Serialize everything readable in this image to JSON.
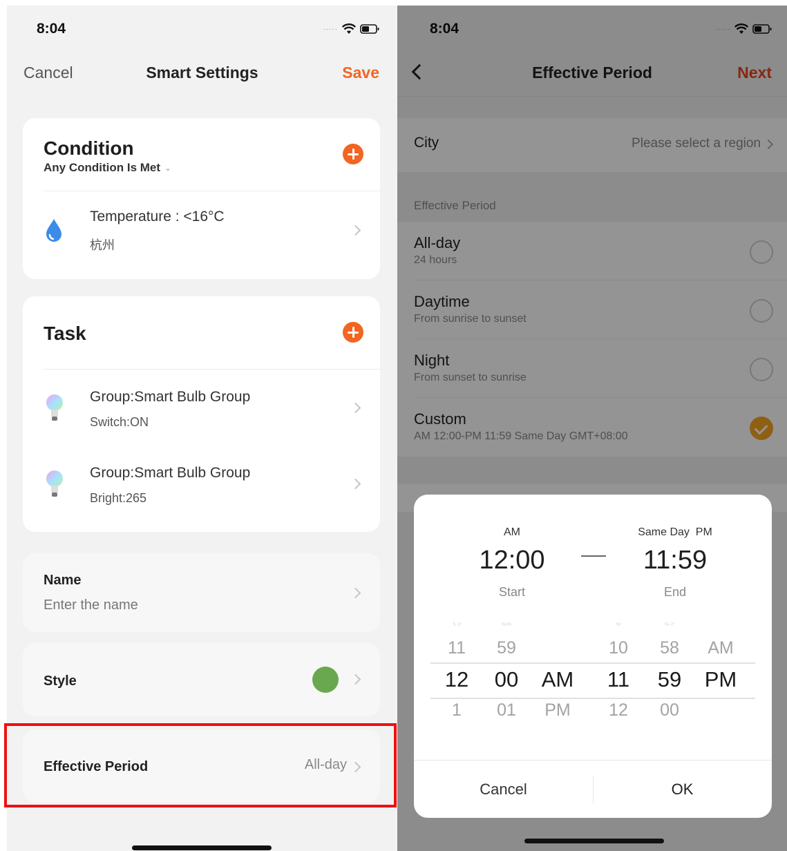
{
  "left": {
    "status": {
      "time": "8:04"
    },
    "nav": {
      "cancel": "Cancel",
      "title": "Smart Settings",
      "save": "Save"
    },
    "condition": {
      "title": "Condition",
      "mode": "Any Condition Is Met",
      "items": [
        {
          "icon": "water-drop-icon",
          "title": "Temperature : <16°C",
          "subtitle": "杭州"
        }
      ]
    },
    "task": {
      "title": "Task",
      "items": [
        {
          "icon": "smart-bulb-icon",
          "title": "Group:Smart Bulb Group",
          "subtitle": "Switch:ON"
        },
        {
          "icon": "smart-bulb-icon",
          "title": "Group:Smart Bulb Group",
          "subtitle": "Bright:265"
        }
      ]
    },
    "name": {
      "label": "Name",
      "placeholder": "Enter the name"
    },
    "style": {
      "label": "Style",
      "color": "#6aa84f"
    },
    "effective_period": {
      "label": "Effective Period",
      "value": "All-day"
    },
    "accent_color": "#f26522",
    "highlight_color": "#ef1010"
  },
  "right": {
    "status": {
      "time": "8:04"
    },
    "nav": {
      "title": "Effective Period",
      "next": "Next"
    },
    "city": {
      "label": "City",
      "value": "Please select a region"
    },
    "section_header": "Effective Period",
    "options": [
      {
        "title": "All-day",
        "subtitle": "24 hours",
        "checked": false
      },
      {
        "title": "Daytime",
        "subtitle": "From sunrise to sunset",
        "checked": false
      },
      {
        "title": "Night",
        "subtitle": "From sunset to sunrise",
        "checked": false
      },
      {
        "title": "Custom",
        "subtitle": "AM 12:00-PM 11:59 Same Day GMT+08:00",
        "checked": true
      }
    ],
    "picker": {
      "start": {
        "ampm": "AM",
        "time": "12:00",
        "caption": "Start"
      },
      "end": {
        "day_ampm": "Same Day  PM",
        "time": "11:59",
        "caption": "End"
      },
      "wheels": {
        "start_hour": {
          "prev": "11",
          "selected": "12",
          "next": "1"
        },
        "start_minute": {
          "prev": "59",
          "selected": "00",
          "next": "01"
        },
        "start_ampm": {
          "prev": "",
          "selected": "AM",
          "next": "PM"
        },
        "end_hour": {
          "prev": "10",
          "selected": "11",
          "next": "12"
        },
        "end_minute": {
          "prev": "58",
          "selected": "59",
          "next": "00"
        },
        "end_ampm": {
          "prev": "AM",
          "selected": "PM",
          "next": ""
        }
      },
      "cancel": "Cancel",
      "ok": "OK"
    },
    "checked_color": "#f6a623",
    "next_color": "#e8461f"
  }
}
